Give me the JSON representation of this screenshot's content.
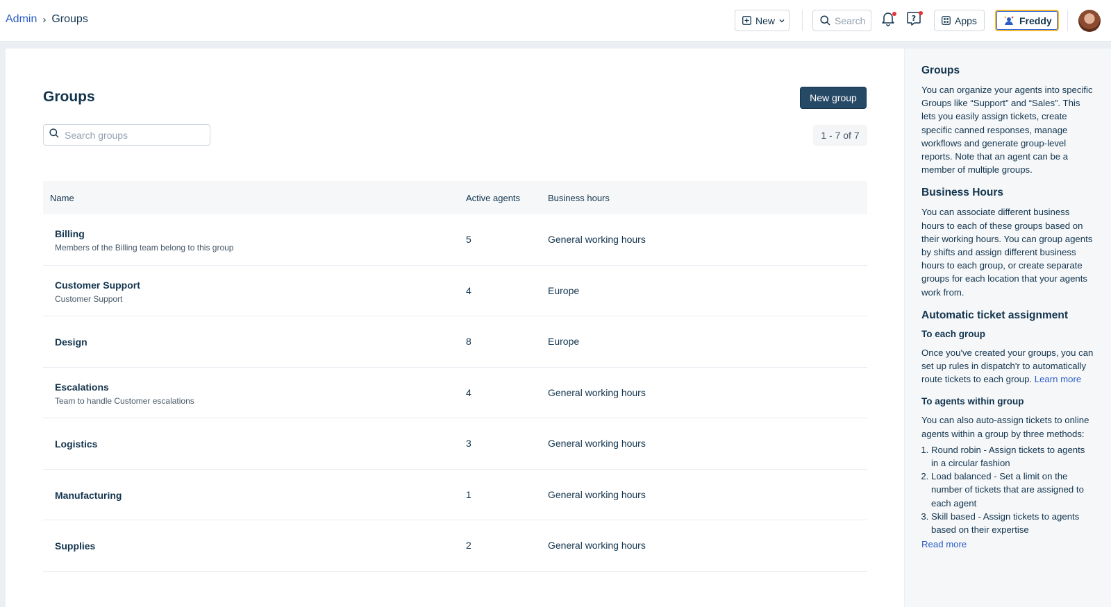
{
  "header": {
    "breadcrumb_root": "Admin",
    "breadcrumb_separator": "›",
    "breadcrumb_current": "Groups",
    "new_label": "New",
    "search_label": "Search",
    "apps_label": "Apps",
    "freddy_label": "Freddy",
    "icons": [
      "plus-square-icon",
      "chevron-down-icon",
      "search-icon",
      "bell-icon",
      "help-icon",
      "apps-grid-icon",
      "freddy-icon",
      "avatar"
    ],
    "colors": {
      "link": "#2c5cc5",
      "notification_dot": "#e43538",
      "freddy_border": "#f5b936"
    }
  },
  "main": {
    "title": "Groups",
    "new_group_label": "New group",
    "search_placeholder": "Search groups",
    "pagination": "1 - 7 of 7",
    "columns": {
      "name": "Name",
      "active_agents": "Active agents",
      "business_hours": "Business hours"
    },
    "rows": [
      {
        "name": "Billing",
        "description": "Members of the Billing team belong to this group",
        "active_agents": "5",
        "business_hours": "General working hours"
      },
      {
        "name": "Customer Support",
        "description": "Customer Support",
        "active_agents": "4",
        "business_hours": "Europe"
      },
      {
        "name": "Design",
        "description": "",
        "active_agents": "8",
        "business_hours": "Europe"
      },
      {
        "name": "Escalations",
        "description": "Team to handle Customer escalations",
        "active_agents": "4",
        "business_hours": "General working hours"
      },
      {
        "name": "Logistics",
        "description": "",
        "active_agents": "3",
        "business_hours": "General working hours"
      },
      {
        "name": "Manufacturing",
        "description": "",
        "active_agents": "1",
        "business_hours": "General working hours"
      },
      {
        "name": "Supplies",
        "description": "",
        "active_agents": "2",
        "business_hours": "General working hours"
      }
    ],
    "colors": {
      "primary_button": "#264966"
    }
  },
  "help": {
    "groups_title": "Groups",
    "groups_text": "You can organize your agents into specific Groups like “Support” and “Sales”. This lets you easily assign tickets, create specific canned responses, manage workflows and generate group-level reports. Note that an agent can be a member of multiple groups.",
    "hours_title": "Business Hours",
    "hours_text": "You can associate different business hours to each of these groups based on their working hours. You can group agents by shifts and assign different business hours to each group, or create separate groups for each location that your agents work from.",
    "assign_title": "Automatic ticket assignment",
    "to_group_title": "To each group",
    "to_group_text": "Once you've created your groups, you can set up rules in dispatch'r to automatically route tickets to each group.",
    "learn_more": "Learn more",
    "within_title": "To agents within group",
    "within_text": "You can also auto-assign tickets to online agents within a group by three methods:",
    "methods": [
      "Round robin - Assign tickets to agents in a circular fashion",
      "Load balanced - Set a limit on the number of tickets that are assigned to each agent",
      "Skill based - Assign tickets to agents based on their expertise"
    ],
    "read_more": "Read more"
  }
}
